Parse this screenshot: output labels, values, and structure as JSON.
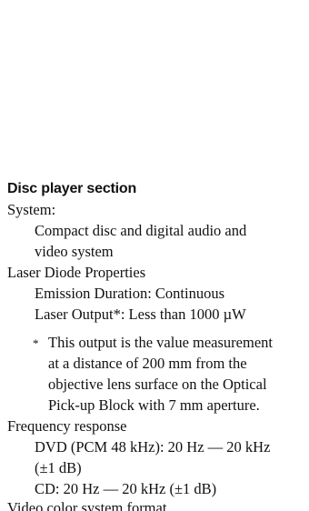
{
  "section": {
    "heading": "Disc player section",
    "system": {
      "label": "System:",
      "value_line1": "Compact disc and digital audio and",
      "value_line2": "video system"
    },
    "laser": {
      "label": "Laser Diode Properties",
      "emission": "Emission Duration: Continuous",
      "output": "Laser Output*: Less than 1000 µW",
      "footnote_marker": "*",
      "footnote_lines": [
        "This output is the value measurement",
        "at a distance of 200 mm from the",
        "objective lens surface on the Optical",
        "Pick-up Block with 7 mm aperture."
      ]
    },
    "frequency": {
      "label": "Frequency response",
      "dvd_line1": "DVD (PCM 48 kHz): 20 Hz — 20 kHz",
      "dvd_line2": "(±1 dB)",
      "cd": "CD: 20 Hz — 20 kHz (±1 dB)"
    },
    "video": {
      "label": "Video color system format"
    }
  }
}
